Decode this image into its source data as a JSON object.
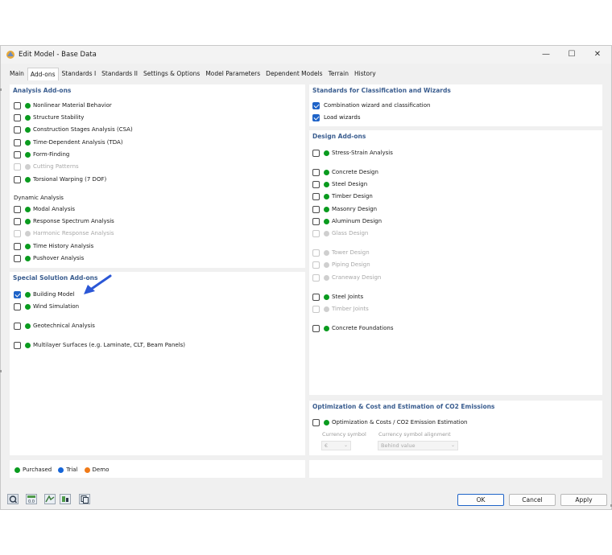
{
  "window": {
    "title": "Edit Model - Base Data",
    "minimize": "—",
    "maximize": "☐",
    "close": "✕"
  },
  "tabs": [
    "Main",
    "Add-ons",
    "Standards I",
    "Standards II",
    "Settings & Options",
    "Model Parameters",
    "Dependent Models",
    "Terrain",
    "History"
  ],
  "analysis_addons": {
    "title": "Analysis Add-ons",
    "items": [
      {
        "label": "Nonlinear Material Behavior",
        "status": "green",
        "checked": false,
        "disabled": false
      },
      {
        "label": "Structure Stability",
        "status": "green",
        "checked": false,
        "disabled": false
      },
      {
        "label": "Construction Stages Analysis (CSA)",
        "status": "green",
        "checked": false,
        "disabled": false
      },
      {
        "label": "Time-Dependent Analysis (TDA)",
        "status": "green",
        "checked": false,
        "disabled": false
      },
      {
        "label": "Form-Finding",
        "status": "green",
        "checked": false,
        "disabled": false
      },
      {
        "label": "Cutting Patterns",
        "status": "grey",
        "checked": false,
        "disabled": true
      },
      {
        "label": "Torsional Warping (7 DOF)",
        "status": "green",
        "checked": false,
        "disabled": false
      }
    ],
    "dynamic_title": "Dynamic Analysis",
    "dynamic_items": [
      {
        "label": "Modal Analysis",
        "status": "green",
        "checked": false,
        "disabled": false
      },
      {
        "label": "Response Spectrum Analysis",
        "status": "green",
        "checked": false,
        "disabled": false
      },
      {
        "label": "Harmonic Response Analysis",
        "status": "grey",
        "checked": false,
        "disabled": true
      },
      {
        "label": "Time History Analysis",
        "status": "green",
        "checked": false,
        "disabled": false
      },
      {
        "label": "Pushover Analysis",
        "status": "green",
        "checked": false,
        "disabled": false
      }
    ]
  },
  "special_addons": {
    "title": "Special Solution Add-ons",
    "items": [
      {
        "label": "Building Model",
        "status": "green",
        "checked": true,
        "disabled": false
      },
      {
        "label": "Wind Simulation",
        "status": "green",
        "checked": false,
        "disabled": false
      },
      {
        "label": "Geotechnical Analysis",
        "status": "green",
        "checked": false,
        "disabled": false
      },
      {
        "label": "Multilayer Surfaces (e.g. Laminate, CLT, Beam Panels)",
        "status": "green",
        "checked": false,
        "disabled": false
      }
    ]
  },
  "standards": {
    "title": "Standards for Classification and Wizards",
    "items": [
      {
        "label": "Combination wizard and classification",
        "checked": true
      },
      {
        "label": "Load wizards",
        "checked": true
      }
    ]
  },
  "design_addons": {
    "title": "Design Add-ons",
    "items": [
      {
        "label": "Stress-Strain Analysis",
        "status": "green",
        "checked": false,
        "disabled": false
      },
      {
        "label": "Concrete Design",
        "status": "green",
        "checked": false,
        "disabled": false
      },
      {
        "label": "Steel Design",
        "status": "green",
        "checked": false,
        "disabled": false
      },
      {
        "label": "Timber Design",
        "status": "green",
        "checked": false,
        "disabled": false
      },
      {
        "label": "Masonry Design",
        "status": "green",
        "checked": false,
        "disabled": false
      },
      {
        "label": "Aluminum Design",
        "status": "green",
        "checked": false,
        "disabled": false
      },
      {
        "label": "Glass Design",
        "status": "grey",
        "checked": false,
        "disabled": true
      },
      {
        "label": "Tower Design",
        "status": "grey",
        "checked": false,
        "disabled": true
      },
      {
        "label": "Piping Design",
        "status": "grey",
        "checked": false,
        "disabled": true
      },
      {
        "label": "Craneway Design",
        "status": "grey",
        "checked": false,
        "disabled": true
      },
      {
        "label": "Steel Joints",
        "status": "green",
        "checked": false,
        "disabled": false
      },
      {
        "label": "Timber Joints",
        "status": "grey",
        "checked": false,
        "disabled": true
      },
      {
        "label": "Concrete Foundations",
        "status": "green",
        "checked": false,
        "disabled": false
      }
    ]
  },
  "optimization": {
    "title": "Optimization & Cost and Estimation of CO2 Emissions",
    "item_label": "Optimization & Costs / CO2 Emission Estimation",
    "currency_symbol_label": "Currency symbol",
    "currency_symbol_value": "€",
    "alignment_label": "Currency symbol alignment",
    "alignment_value": "Behind value"
  },
  "legend": {
    "purchased": "Purchased",
    "trial": "Trial",
    "demo": "Demo",
    "colors": {
      "purchased": "#0a9b1f",
      "trial": "#1565d8",
      "demo": "#f07a18"
    }
  },
  "buttons": {
    "ok": "OK",
    "cancel": "Cancel",
    "apply": "Apply"
  },
  "toolbar_icons": [
    "help-icon",
    "units-icon",
    "model-settings-icon",
    "add-ons-icon",
    "copy-icon"
  ]
}
